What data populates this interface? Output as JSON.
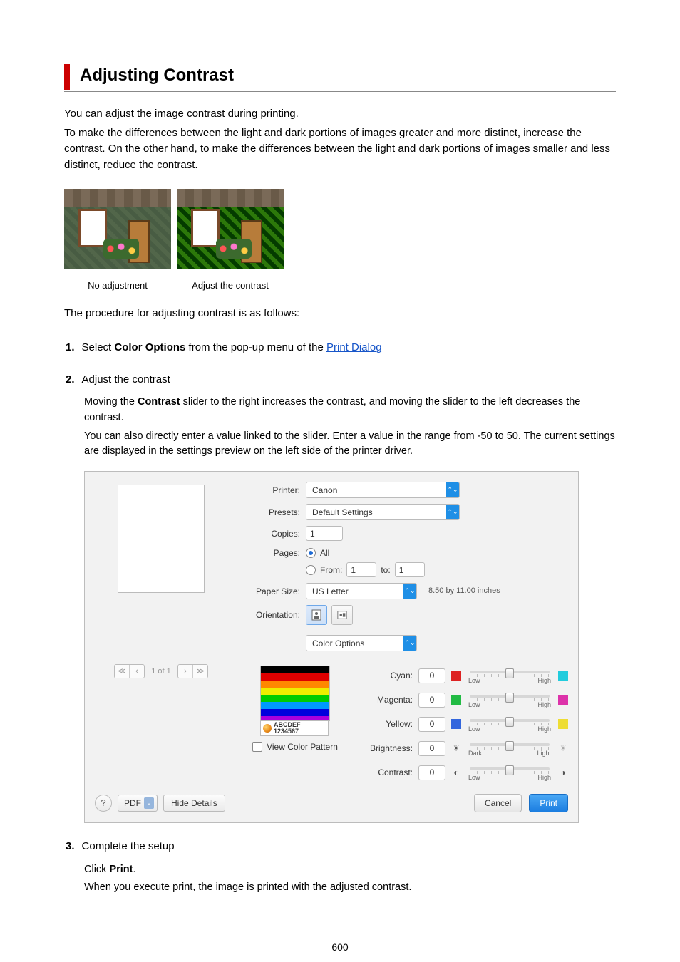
{
  "page": {
    "title": "Adjusting Contrast",
    "number": "600"
  },
  "intro": {
    "p1": "You can adjust the image contrast during printing.",
    "p2": "To make the differences between the light and dark portions of images greater and more distinct, increase the contrast. On the other hand, to make the differences between the light and dark portions of images smaller and less distinct, reduce the contrast."
  },
  "examples": {
    "caption_none": "No adjustment",
    "caption_adj": "Adjust the contrast"
  },
  "procedure_line": "The procedure for adjusting contrast is as follows:",
  "steps": {
    "s1": {
      "num": "1.",
      "prefix": "Select ",
      "bold": "Color Options",
      "mid": " from the pop-up menu of the ",
      "link": "Print Dialog"
    },
    "s2": {
      "num": "2.",
      "title": "Adjust the contrast",
      "b1a": "Moving the ",
      "b1bold": "Contrast",
      "b1b": " slider to the right increases the contrast, and moving the slider to the left decreases the contrast.",
      "b2": "You can also directly enter a value linked to the slider. Enter a value in the range from -50 to 50. The current settings are displayed in the settings preview on the left side of the printer driver."
    },
    "s3": {
      "num": "3.",
      "title": "Complete the setup",
      "b1a": "Click ",
      "b1bold": "Print",
      "b1b": ".",
      "b2": "When you execute print, the image is printed with the adjusted contrast."
    }
  },
  "dialog": {
    "printer": {
      "label": "Printer:",
      "value": "Canon"
    },
    "presets": {
      "label": "Presets:",
      "value": "Default Settings"
    },
    "copies": {
      "label": "Copies:",
      "value": "1"
    },
    "pages": {
      "label": "Pages:",
      "all": "All",
      "from_lbl": "From:",
      "from_val": "1",
      "to_lbl": "to:",
      "to_val": "1"
    },
    "paper": {
      "label": "Paper Size:",
      "value": "US Letter",
      "dim": "8.50 by 11.00 inches"
    },
    "orientation": {
      "label": "Orientation:"
    },
    "popup_section": "Color Options",
    "preview_text": {
      "line1": "ABCDEF",
      "line2": "1234567"
    },
    "pager": "1 of 1",
    "view_pattern": "View Color Pattern",
    "sliders": {
      "cyan": {
        "label": "Cyan:",
        "value": "0",
        "left": "Low",
        "right": "High"
      },
      "magenta": {
        "label": "Magenta:",
        "value": "0",
        "left": "Low",
        "right": "High"
      },
      "yellow": {
        "label": "Yellow:",
        "value": "0",
        "left": "Low",
        "right": "High"
      },
      "brightness": {
        "label": "Brightness:",
        "value": "0",
        "left": "Dark",
        "right": "Light"
      },
      "contrast": {
        "label": "Contrast:",
        "value": "0",
        "left": "Low",
        "right": "High"
      }
    },
    "footer": {
      "help": "?",
      "pdf": "PDF",
      "hide": "Hide Details",
      "cancel": "Cancel",
      "print": "Print"
    }
  }
}
